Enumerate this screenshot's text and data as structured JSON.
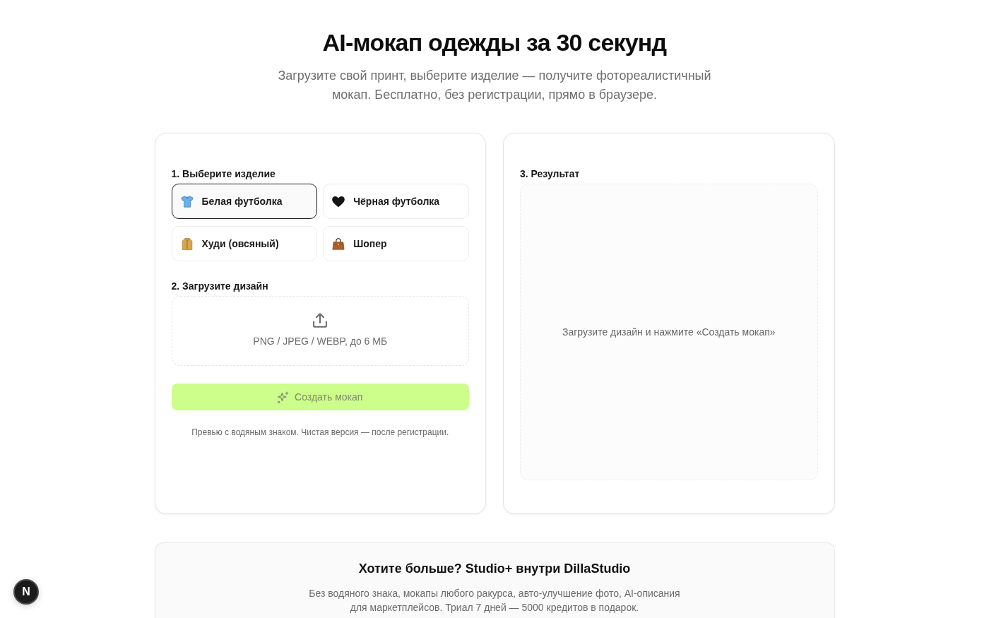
{
  "hero": {
    "title": "AI-мокап одежды за 30 секунд",
    "subtitle": "Загрузите свой принт, выберите изделие — получите фотореалистичный мокап. Бесплатно, без регистрации, прямо в браузере."
  },
  "builder": {
    "product_label": "1. Выберите изделие",
    "products": [
      {
        "label": "Белая футболка",
        "selected": true
      },
      {
        "label": "Чёрная футболка",
        "selected": false
      },
      {
        "label": "Худи (овсяный)",
        "selected": false
      },
      {
        "label": "Шопер",
        "selected": false
      }
    ],
    "upload_label": "2. Загрузите дизайн",
    "dropzone": {
      "hint": "PNG / JPEG / WEBP, до 6 МБ"
    },
    "create_button": {
      "label": "Создать мокап",
      "disabled": true
    },
    "note": "Превью с водяным знаком. Чистая версия — после регистрации."
  },
  "result": {
    "label": "3. Результат",
    "message": "Загрузите дизайн и нажмите «Создать мокап»"
  },
  "promo": {
    "title": "Хотите больше? Studio+ внутри DillaStudio",
    "text": "Без водяного знака, мокапы любого ракурса, авто-улучшение фото, AI-описания для маркетплейсов. Триал 7 дней — 5000 кредитов в подарок."
  },
  "dev_indicator": {
    "label": "N"
  }
}
